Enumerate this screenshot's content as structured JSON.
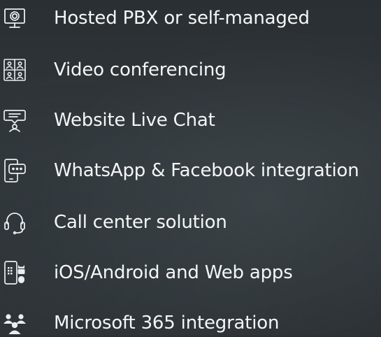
{
  "features": [
    {
      "icon": "monitor-gear-icon",
      "label": "Hosted PBX or self-managed"
    },
    {
      "icon": "video-grid-icon",
      "label": "Video conferencing"
    },
    {
      "icon": "chat-agent-icon",
      "label": "Website Live Chat"
    },
    {
      "icon": "phone-chat-icon",
      "label": "WhatsApp & Facebook integration"
    },
    {
      "icon": "headset-icon",
      "label": "Call center solution"
    },
    {
      "icon": "mobile-apps-icon",
      "label": "iOS/Android and Web apps"
    },
    {
      "icon": "team-icon",
      "label": "Microsoft 365 integration"
    }
  ],
  "colors": {
    "text": "#f4f6f7",
    "icon": "#e9eef1",
    "background": "#2e3438"
  }
}
